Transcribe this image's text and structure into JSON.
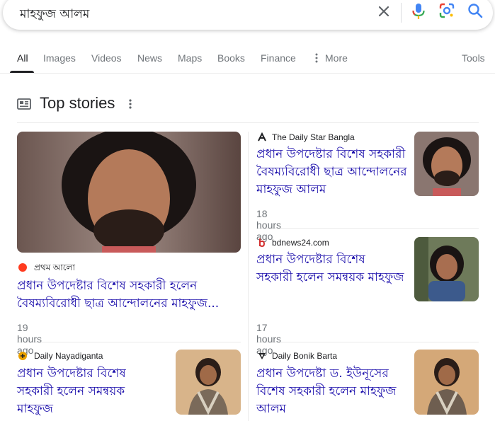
{
  "search": {
    "query": "মাহফুজ আলম"
  },
  "tabs": [
    "All",
    "Images",
    "Videos",
    "News",
    "Maps",
    "Books",
    "Finance",
    "More",
    "Tools"
  ],
  "top_stories": {
    "title": "Top stories",
    "stories": [
      {
        "source": "প্রথম আলো",
        "headline": "প্রধান উপদেষ্টার বিশেষ সহকারী হলেন বৈষম্যবিরোধী ছাত্র আন্দোলনের মাহফুজ...",
        "time": "19 hours ago",
        "favicon_color": "#ff3b1f"
      },
      {
        "source": "The Daily Star Bangla",
        "headline": "প্রধান উপদেষ্টার বিশেষ সহকারী বৈষম্যবিরোধী ছাত্র আন্দোলনের মাহফুজ আলম",
        "time": "18 hours ago",
        "favicon_color": "#202124"
      },
      {
        "source": "bdnews24.com",
        "headline": "প্রধান উপদেষ্টার বিশেষ সহকারী হলেন সমন্বয়ক মাহফুজ",
        "time": "17 hours ago",
        "favicon_color": "#d32f2f"
      },
      {
        "source": "Daily Nayadiganta",
        "headline": "প্রধান উপদেষ্টার বিশেষ সহকারী হলেন সমন্বয়ক মাহফুজ",
        "time": "",
        "favicon_color": "#e8a000"
      },
      {
        "source": "Daily Bonik Barta",
        "headline": "প্রধান উপদেষ্টা ড. ইউনূসের বিশেষ সহকারী হলেন মাহফুজ আলম",
        "time": "",
        "favicon_color": "#202124"
      }
    ]
  },
  "colors": {
    "link": "#1a0dab",
    "muted": "#70757a",
    "divider": "#ebebeb"
  }
}
